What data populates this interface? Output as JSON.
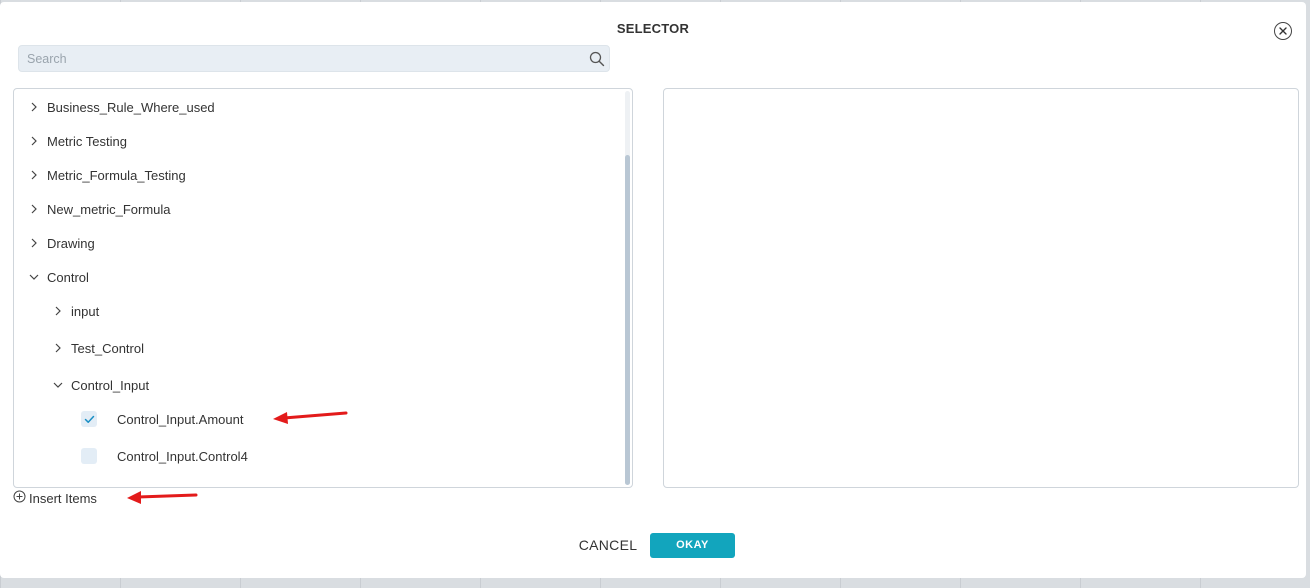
{
  "dialog": {
    "title": "SELECTOR",
    "close_icon": "close-circle-icon"
  },
  "search": {
    "placeholder": "Search",
    "value": "",
    "icon": "search-icon"
  },
  "tree": [
    {
      "label": "Business_Rule_Where_used",
      "level": 0,
      "expanded": false
    },
    {
      "label": "Metric Testing",
      "level": 0,
      "expanded": false
    },
    {
      "label": "Metric_Formula_Testing",
      "level": 0,
      "expanded": false
    },
    {
      "label": "New_metric_Formula",
      "level": 0,
      "expanded": false
    },
    {
      "label": "Drawing",
      "level": 0,
      "expanded": false
    },
    {
      "label": "Control",
      "level": 0,
      "expanded": true
    },
    {
      "label": "input",
      "level": 1,
      "expanded": false
    },
    {
      "label": "Test_Control",
      "level": 1,
      "expanded": false
    },
    {
      "label": "Control_Input",
      "level": 1,
      "expanded": true
    },
    {
      "label": "Control_Input.Amount",
      "level": 2,
      "checked": true
    },
    {
      "label": "Control_Input.Control4",
      "level": 2,
      "checked": false
    }
  ],
  "insert_items": {
    "label": "Insert Items",
    "icon": "plus-circle-icon"
  },
  "buttons": {
    "cancel": "CANCEL",
    "okay": "OKAY"
  },
  "colors": {
    "accent": "#12a5bd",
    "annotation_arrow": "#e31b1b"
  }
}
